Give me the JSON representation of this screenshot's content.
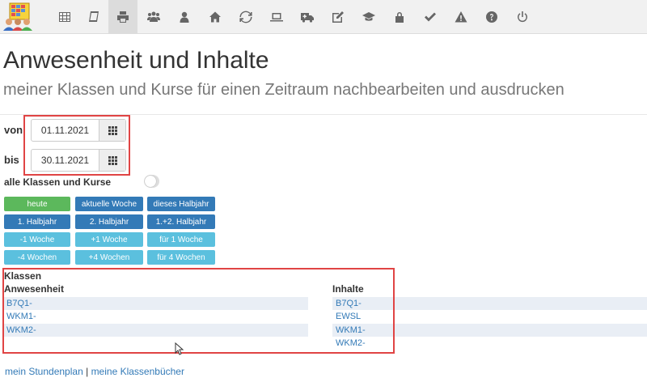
{
  "nav": {
    "icons": [
      "table-icon",
      "book-icon",
      "print-icon",
      "users-icon",
      "user-icon",
      "home-icon",
      "refresh-icon",
      "laptop-icon",
      "ambulance-icon",
      "edit-icon",
      "graduation-cap-icon",
      "lock-icon",
      "check-icon",
      "warning-icon",
      "help-icon",
      "power-icon"
    ],
    "active": "print-icon"
  },
  "page": {
    "title": "Anwesenheit und Inhalte",
    "subtitle": "meiner Klassen und Kurse für einen Zeitraum nachbearbeiten und ausdrucken"
  },
  "form": {
    "von_label": "von",
    "von_value": "01.11.2021",
    "bis_label": "bis",
    "bis_value": "30.11.2021",
    "all_label": "alle Klassen und Kurse",
    "all_enabled": false
  },
  "buttons": {
    "heute": "heute",
    "aktuelle_woche": "aktuelle Woche",
    "dieses_halbjahr": "dieses Halbjahr",
    "halbjahr1": "1. Halbjahr",
    "halbjahr2": "2. Halbjahr",
    "halbjahr12": "1.+2. Halbjahr",
    "minus1": "-1 Woche",
    "plus1": "+1 Woche",
    "fuer1": "für 1 Woche",
    "minus4": "-4 Wochen",
    "plus4": "+4 Wochen",
    "fuer4": "für 4 Wochen"
  },
  "colors": {
    "success": "#5cb85c",
    "primary": "#337ab7",
    "info": "#5bc0de",
    "highlight": "#e04444"
  },
  "klassen": {
    "heading": "Klassen",
    "anwesenheit_heading": "Anwesenheit",
    "inhalte_heading": "Inhalte",
    "anwesenheit": [
      "B7Q1-",
      "WKM1-",
      "WKM2-"
    ],
    "inhalte": [
      "B7Q1-",
      "EWSL",
      "WKM1-",
      "WKM2-"
    ]
  },
  "footer": {
    "link1": "mein Stundenplan",
    "separator": "|",
    "link2": "meine Klassenbücher"
  }
}
